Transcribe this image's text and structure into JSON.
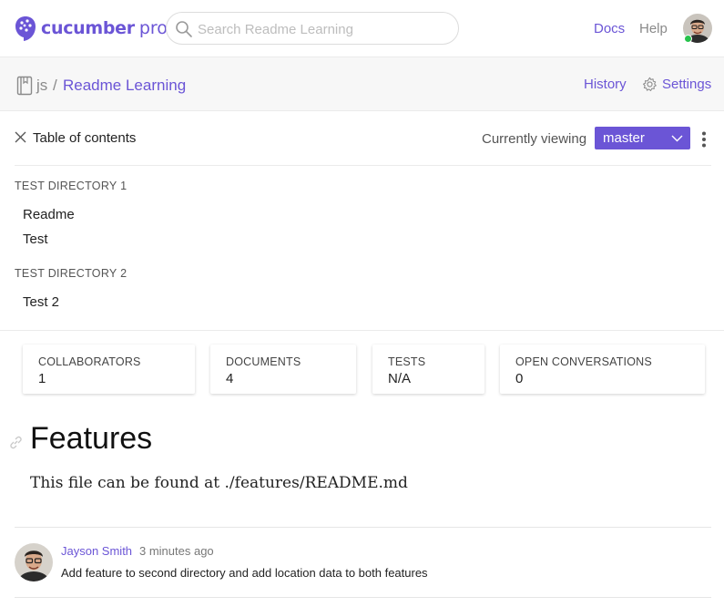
{
  "brand": {
    "name": "cucumber",
    "suffix": "pro",
    "color": "#6b55d6"
  },
  "search": {
    "placeholder": "Search Readme Learning",
    "value": ""
  },
  "nav": {
    "docs": "Docs",
    "help": "Help",
    "user_status": "online"
  },
  "breadcrumb": {
    "org": "js",
    "separator": "/",
    "project": "Readme Learning"
  },
  "header_actions": {
    "history": "History",
    "settings": "Settings"
  },
  "toc": {
    "title": "Table of contents",
    "viewing_label": "Currently viewing",
    "branch": "master",
    "directories": [
      {
        "name": "TEST DIRECTORY 1",
        "items": [
          "Readme",
          "Test"
        ]
      },
      {
        "name": "TEST DIRECTORY 2",
        "items": [
          "Test 2"
        ]
      }
    ]
  },
  "stats": [
    {
      "label": "COLLABORATORS",
      "value": "1"
    },
    {
      "label": "DOCUMENTS",
      "value": "4"
    },
    {
      "label": "TESTS",
      "value": "N/A"
    },
    {
      "label": "OPEN CONVERSATIONS",
      "value": "0"
    }
  ],
  "document": {
    "title": "Features",
    "body": "This file can be found at ./features/README.md"
  },
  "commit": {
    "author": "Jayson Smith",
    "time": "3 minutes ago",
    "message": "Add feature to second directory and add location data to both features"
  },
  "icons": [
    "cucumber-logo-icon",
    "search-icon",
    "avatar",
    "book-icon",
    "gear-icon",
    "close-icon",
    "chevron-down-icon",
    "kebab-menu-icon",
    "link-anchor-icon"
  ]
}
